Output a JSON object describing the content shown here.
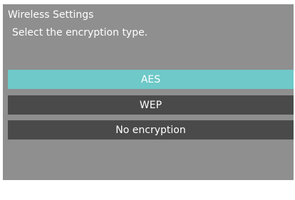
{
  "dialog": {
    "title": "Wireless Settings",
    "instruction": "Select the encryption type."
  },
  "options": [
    {
      "label": "AES",
      "selected": true
    },
    {
      "label": "WEP",
      "selected": false
    },
    {
      "label": "No encryption",
      "selected": false
    }
  ],
  "colors": {
    "background": "#8f8f8f",
    "selected": "#6ec9c8",
    "unselected": "#4a4a4a",
    "text": "#ffffff"
  }
}
